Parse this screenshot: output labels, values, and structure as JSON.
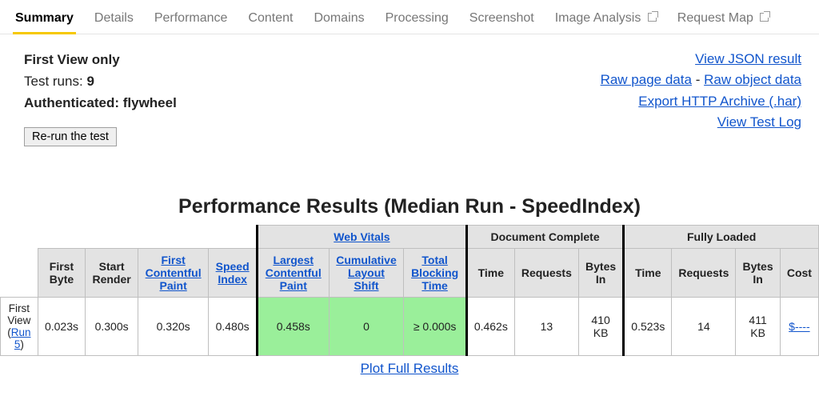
{
  "tabs": {
    "summary": "Summary",
    "details": "Details",
    "performance": "Performance",
    "content": "Content",
    "domains": "Domains",
    "processing": "Processing",
    "screenshot": "Screenshot",
    "image_analysis": "Image Analysis",
    "request_map": "Request Map"
  },
  "meta": {
    "view_mode": "First View only",
    "test_runs_label": "Test runs:",
    "test_runs_value": "9",
    "auth_label": "Authenticated:",
    "auth_value": "flywheel",
    "rerun_label": "Re-run the test"
  },
  "links": {
    "view_json": "View JSON result",
    "raw_page": "Raw page data",
    "raw_object": "Raw object data",
    "export_har": "Export HTTP Archive (.har)",
    "view_log": "View Test Log",
    "dash": "-"
  },
  "results": {
    "title": "Performance Results (Median Run - SpeedIndex)",
    "group_web_vitals": "Web Vitals",
    "group_doc_complete": "Document Complete",
    "group_fully_loaded": "Fully Loaded",
    "headers": {
      "first_byte": "First Byte",
      "start_render": "Start Render",
      "fcp": "First Contentful Paint",
      "speed_index": "Speed Index",
      "lcp": "Largest Contentful Paint",
      "cls": "Cumulative Layout Shift",
      "tbt": "Total Blocking Time",
      "time": "Time",
      "requests": "Requests",
      "bytes_in": "Bytes In",
      "cost": "Cost"
    },
    "row": {
      "label_line1": "First View",
      "run_link": "Run 5",
      "first_byte": "0.023s",
      "start_render": "0.300s",
      "fcp": "0.320s",
      "speed_index": "0.480s",
      "lcp": "0.458s",
      "cls": "0",
      "tbt": "≥ 0.000s",
      "dc_time": "0.462s",
      "dc_requests": "13",
      "dc_bytes": "410 KB",
      "fl_time": "0.523s",
      "fl_requests": "14",
      "fl_bytes": "411 KB",
      "cost": "$----"
    },
    "plot_link": "Plot Full Results"
  }
}
